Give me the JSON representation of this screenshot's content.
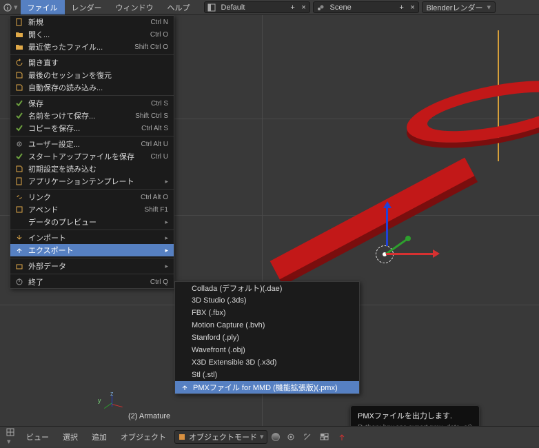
{
  "topmenu": {
    "file": "ファイル",
    "render": "レンダー",
    "window": "ウィンドウ",
    "help": "ヘルプ"
  },
  "topfields": {
    "layout": "Default",
    "scene": "Scene",
    "engine": "Blenderレンダー"
  },
  "filemenu": {
    "new": "新規",
    "new_sc": "Ctrl N",
    "open": "開く...",
    "open_sc": "Ctrl O",
    "recent": "最近使ったファイル...",
    "recent_sc": "Shift Ctrl O",
    "reopen": "開き直す",
    "lastsession": "最後のセッションを復元",
    "autosave": "自動保存の読み込み...",
    "save": "保存",
    "save_sc": "Ctrl S",
    "saveas": "名前をつけて保存...",
    "saveas_sc": "Shift Ctrl S",
    "savecopy": "コピーを保存...",
    "savecopy_sc": "Ctrl Alt S",
    "userpref": "ユーザー設定...",
    "userpref_sc": "Ctrl Alt U",
    "savestartup": "スタートアップファイルを保存",
    "savestartup_sc": "Ctrl U",
    "loadfactory": "初期設定を読み込む",
    "apptemplate": "アプリケーションテンプレート",
    "link": "リンク",
    "link_sc": "Ctrl Alt O",
    "append": "アペンド",
    "append_sc": "Shift F1",
    "preview": "データのプレビュー",
    "import": "インポート",
    "export": "エクスポート",
    "external": "外部データ",
    "quit": "終了",
    "quit_sc": "Ctrl Q"
  },
  "exportmenu": {
    "collada": "Collada (デフォルト)(.dae)",
    "3ds": "3D Studio (.3ds)",
    "fbx": "FBX (.fbx)",
    "bvh": "Motion Capture (.bvh)",
    "ply": "Stanford (.ply)",
    "obj": "Wavefront (.obj)",
    "x3d": "X3D Extensible 3D (.x3d)",
    "stl": "Stl (.stl)",
    "pmx": "PMXファイル for MMD (機能拡張版)(.pmx)"
  },
  "tooltip": {
    "title": "PMXファイルを出力します.",
    "python": "Python: bpy.ops.export.pmx_data_e()"
  },
  "viewport": {
    "label": "(2) Armature",
    "axis_z": "z",
    "axis_y": "y"
  },
  "bottombar": {
    "view": "ビュー",
    "select": "選択",
    "add": "追加",
    "object": "オブジェクト",
    "mode": "オブジェクトモード"
  },
  "icons": {
    "plus": "+",
    "x": "×",
    "tri": "▸",
    "tridn": "▾"
  }
}
